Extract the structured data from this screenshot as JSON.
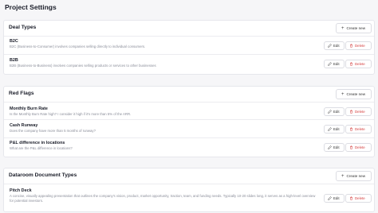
{
  "page": {
    "title": "Project Settings"
  },
  "buttons": {
    "create": "Create new",
    "edit": "Edit",
    "delete": "Delete"
  },
  "colors": {
    "accent_delete": "#d43c3c"
  },
  "sections": [
    {
      "title": "Deal Types",
      "items": [
        {
          "title": "B2C",
          "desc": "B2C (Business-to-Consumer) involves companies selling directly to individual consumers."
        },
        {
          "title": "B2B",
          "desc": "B2B (Business-to-Business) involves companies selling products or services to other businesses"
        }
      ]
    },
    {
      "title": "Red Flags",
      "items": [
        {
          "title": "Monthly Burn Rate",
          "desc": "Is the Monthly Burn Rate high? I consider it high if it's more than 5% of the ARR."
        },
        {
          "title": "Cash Runway",
          "desc": "Does the company have more than 5 months of runway?"
        },
        {
          "title": "P&L difference in locations",
          "desc": "What are the P&L difference in locations?"
        }
      ]
    },
    {
      "title": "Dataroom Document Types",
      "items": [
        {
          "title": "Pitch Deck",
          "desc": "A concise, visually appealing presentation that outlines the company's vision, product, market opportunity, traction, team, and funding needs. Typically 10-20 slides long, it serves as a high-level overview for potential investors."
        }
      ]
    }
  ]
}
